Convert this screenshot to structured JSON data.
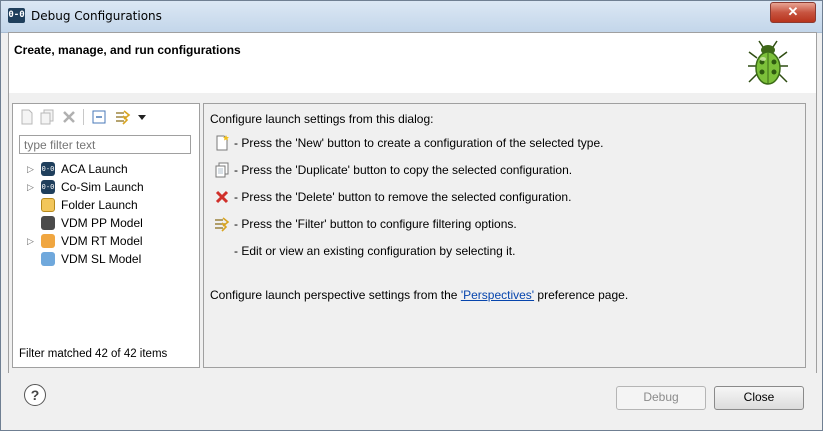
{
  "window": {
    "title": "Debug Configurations",
    "app_icon_text": "0-0",
    "close_glyph": "✕"
  },
  "header": {
    "title": "Create, manage, and run configurations"
  },
  "left": {
    "filter_placeholder": "type filter text",
    "tree": [
      {
        "label": "ACA Launch",
        "expandable": true,
        "icon_color": "#1f3f5c"
      },
      {
        "label": "Co-Sim Launch",
        "expandable": true,
        "icon_color": "#1f3f5c"
      },
      {
        "label": "Folder Launch",
        "expandable": false,
        "icon_color": "#e9b43a"
      },
      {
        "label": "VDM PP Model",
        "expandable": false,
        "icon_color": "#4a4a4a"
      },
      {
        "label": "VDM RT Model",
        "expandable": true,
        "icon_color": "#f0a640"
      },
      {
        "label": "VDM SL Model",
        "expandable": false,
        "icon_color": "#6fa8dc"
      }
    ],
    "status": "Filter matched 42 of 42 items"
  },
  "right": {
    "intro": "Configure launch settings from this dialog:",
    "items": [
      "- Press the 'New' button to create a configuration of the selected type.",
      "- Press the 'Duplicate' button to copy the selected configuration.",
      "- Press the 'Delete' button to remove the selected configuration.",
      "- Press the 'Filter' button to configure filtering options.",
      "- Edit or view an existing configuration by selecting it."
    ],
    "perspective_prefix": "Configure launch perspective settings from the ",
    "perspective_link": "'Perspectives'",
    "perspective_suffix": " preference page."
  },
  "footer": {
    "help_glyph": "?",
    "debug_label": "Debug",
    "close_label": "Close"
  }
}
